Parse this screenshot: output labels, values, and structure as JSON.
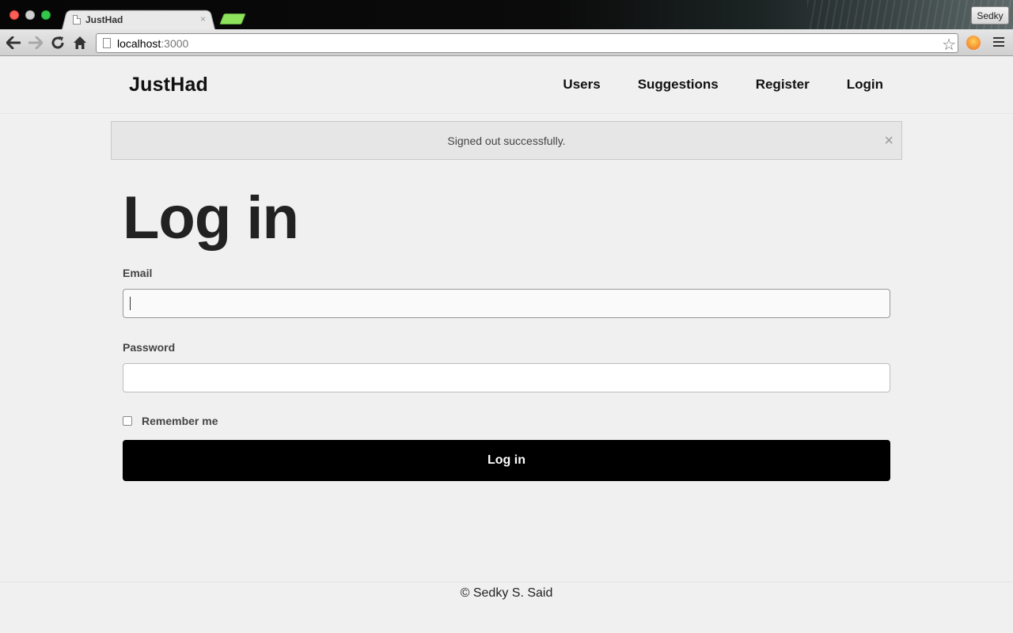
{
  "browser": {
    "tab_title": "JustHad",
    "tab_close": "×",
    "profile_name": "Sedky",
    "url_host": "localhost",
    "url_port": ":3000"
  },
  "navbar": {
    "brand": "JustHad",
    "links": [
      {
        "label": "Users"
      },
      {
        "label": "Suggestions"
      },
      {
        "label": "Register"
      },
      {
        "label": "Login"
      }
    ]
  },
  "alert": {
    "message": "Signed out successfully.",
    "close": "×"
  },
  "form": {
    "title": "Log in",
    "email_label": "Email",
    "email_value": "",
    "password_label": "Password",
    "password_value": "",
    "remember_label": "Remember me",
    "remember_checked": false,
    "submit_label": "Log in"
  },
  "footer": {
    "text": "© Sedky S. Said"
  },
  "icons": {
    "back": "arrow-left-icon",
    "forward": "arrow-right-icon",
    "reload": "reload-icon",
    "home": "home-icon",
    "bookmark": "star-icon",
    "menu": "hamburger-menu-icon"
  },
  "colors": {
    "page_bg": "#f0f0f0",
    "button_bg": "#000000",
    "alert_bg": "#e6e6e6"
  }
}
